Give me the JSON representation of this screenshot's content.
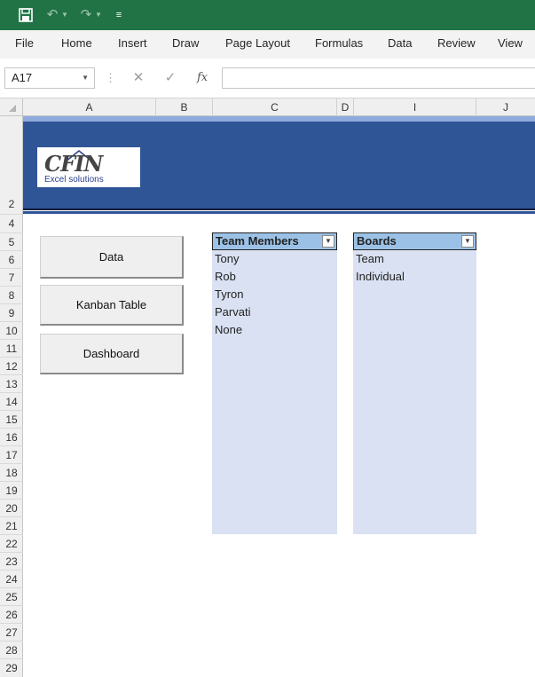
{
  "quick_access": {
    "save_icon": "save-icon",
    "undo_icon": "undo-icon",
    "redo_icon": "redo-icon",
    "customize_icon": "customize-qat-icon"
  },
  "ribbon": {
    "tabs": [
      "File",
      "Home",
      "Insert",
      "Draw",
      "Page Layout",
      "Formulas",
      "Data",
      "Review",
      "View"
    ]
  },
  "formula_bar": {
    "name_box": "A17",
    "fx_label": "fx",
    "formula": ""
  },
  "columns": [
    "A",
    "B",
    "C",
    "D",
    "I",
    "J"
  ],
  "rows": [
    "2",
    "4",
    "5",
    "6",
    "7",
    "8",
    "9",
    "10",
    "11",
    "12",
    "13",
    "14",
    "15",
    "16",
    "17",
    "18",
    "19",
    "20",
    "21",
    "22",
    "23",
    "24",
    "25",
    "26",
    "27",
    "28",
    "29"
  ],
  "logo": {
    "mark": "CFIN",
    "subtitle": "Excel solutions"
  },
  "buttons": [
    "Data",
    "Kanban Table",
    "Dashboard"
  ],
  "team_members": {
    "header": "Team Members",
    "items": [
      "Tony",
      "Rob",
      "Tyron",
      "Parvati",
      "None"
    ]
  },
  "boards": {
    "header": "Boards",
    "items": [
      "Team",
      "Individual"
    ]
  },
  "colors": {
    "title_bar": "#217346",
    "banner": "#2f5597",
    "table_header": "#9bc2e6",
    "table_body": "#d9e1f2"
  }
}
